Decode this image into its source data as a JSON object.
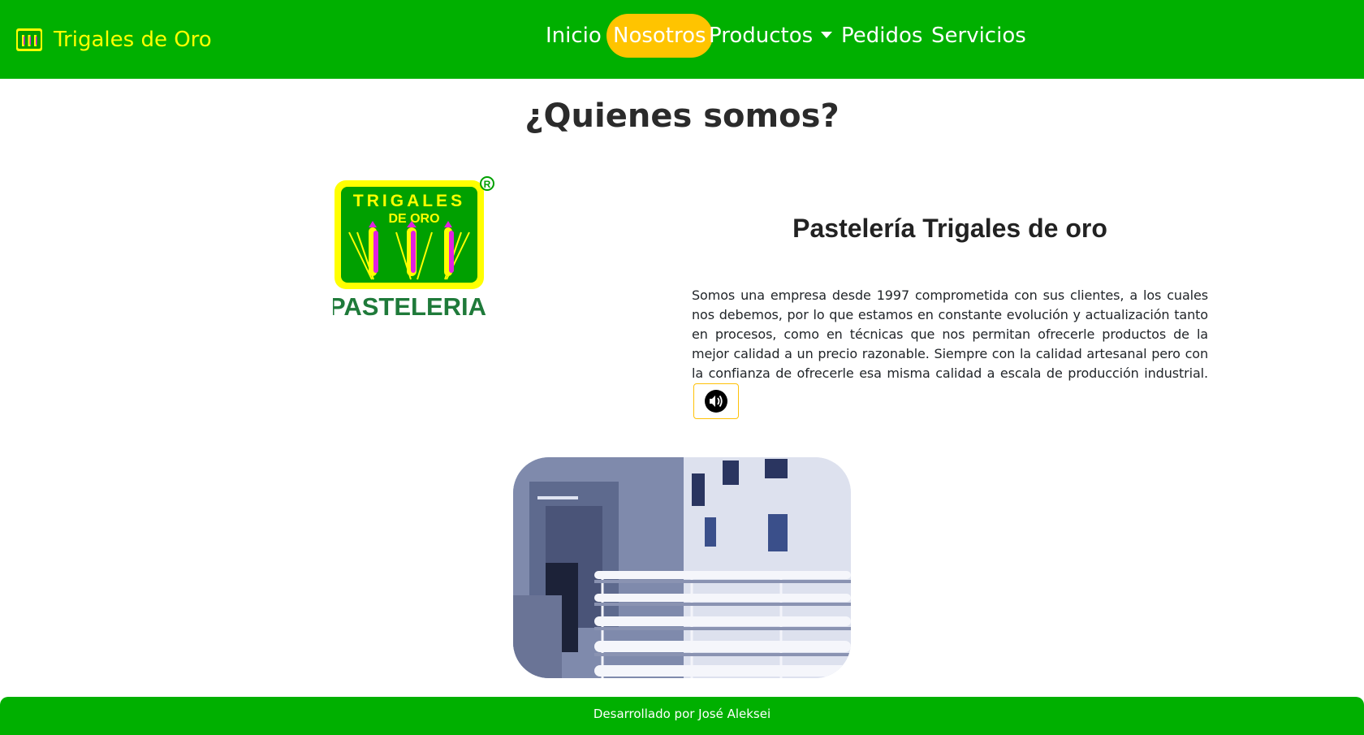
{
  "brand": {
    "name": "Trigales de Oro",
    "icon": "wheat-logo-icon",
    "text_color": "#ffff00"
  },
  "nav": {
    "items": [
      {
        "label": "Inicio",
        "active": false
      },
      {
        "label": "Nosotros",
        "active": true
      },
      {
        "label": "Productos",
        "active": false,
        "dropdown": true
      },
      {
        "label": "Pedidos",
        "active": false
      },
      {
        "label": "Servicios",
        "active": false
      }
    ],
    "active_color": "#ffc400"
  },
  "main": {
    "title": "¿Quienes somos?",
    "heading": "Pastelería Trigales de oro",
    "paragraph": "Somos una empresa desde 1997 comprometida con sus clientes, a los cuales nos debemos, por lo que estamos en constante evolución y actualización tanto en procesos, como en técnicas que nos permitan ofrecerle productos de la mejor calidad a un precio razonable. Siempre con la calidad artesanal pero con la confianza de ofrecerle esa misma calidad a escala de producción industrial.",
    "audio_icon": "speaker-icon",
    "logo": {
      "line1": "TRIGALES",
      "line2": "DE ORO",
      "line3": "PASTELERIA",
      "mark": "®"
    }
  },
  "footer": {
    "text": "Desarrollado por José Aleksei"
  },
  "colors": {
    "primary_green": "#00b000",
    "accent_yellow": "#ffc400"
  }
}
